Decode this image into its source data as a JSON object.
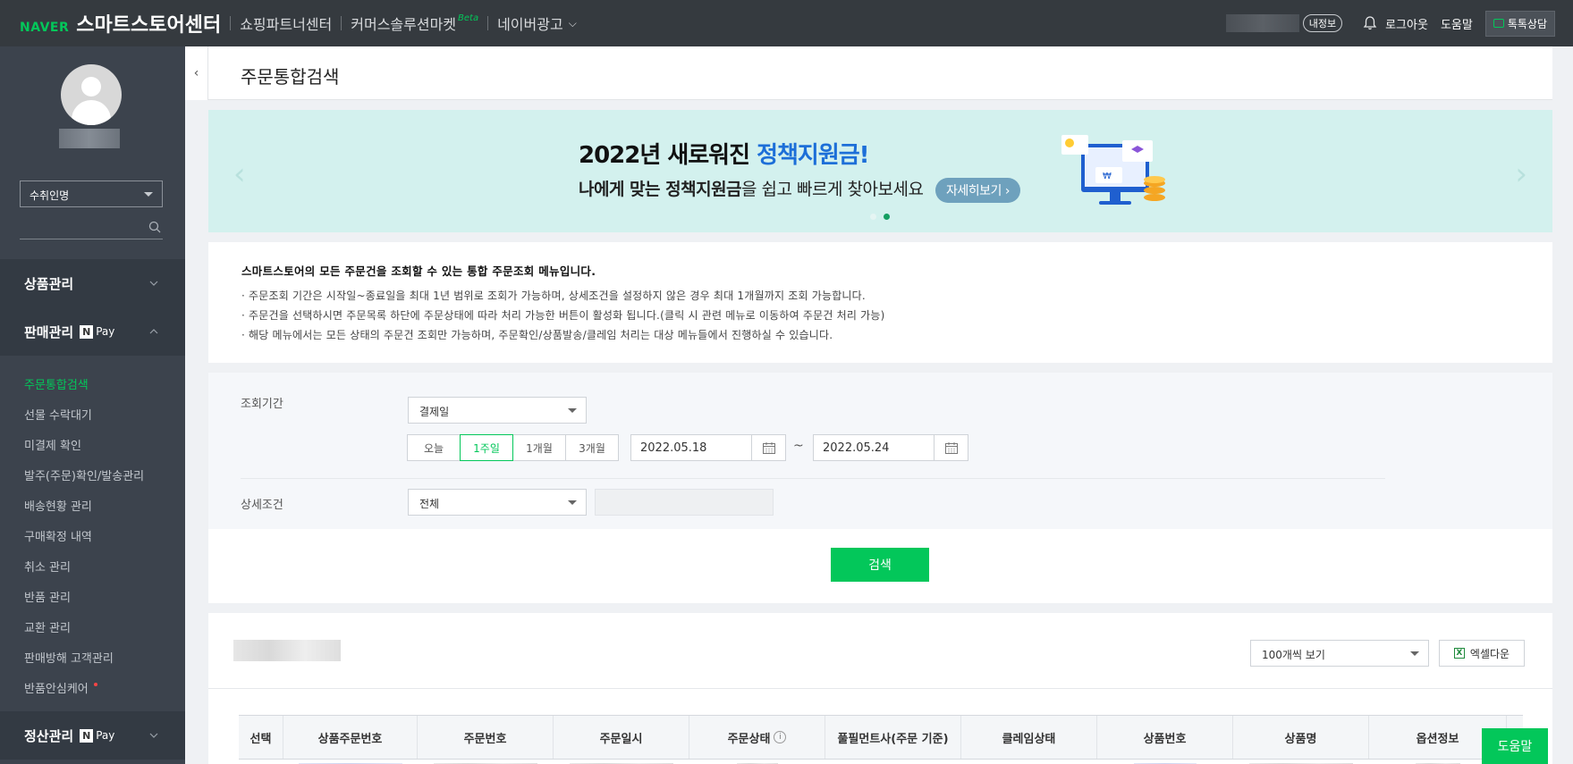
{
  "topbar": {
    "naver": "NAVER",
    "center_title": "스마트스토어센터",
    "links": [
      "쇼핑파트너센터",
      "커머스솔루션마켓",
      "네이버광고"
    ],
    "beta": "Beta",
    "my_info_badge": "내정보",
    "logout": "로그아웃",
    "help": "도움말",
    "talk": "톡톡상담"
  },
  "sidebar": {
    "recipient_select": "수취인명",
    "menus": {
      "product": "상품관리",
      "sales": "판매관리",
      "settlement": "정산관리"
    },
    "npay_label": "Pay",
    "npay_n": "N",
    "sales_items": [
      "주문통합검색",
      "선물 수락대기",
      "미결제 확인",
      "발주(주문)확인/발송관리",
      "배송현황 관리",
      "구매확정 내역",
      "취소 관리",
      "반품 관리",
      "교환 관리",
      "판매방해 고객관리",
      "반품안심케어"
    ]
  },
  "page": {
    "title": "주문통합검색"
  },
  "banner": {
    "title_plain": "2022년 새로워진 ",
    "title_highlight": "정책지원금!",
    "sub_bold": "나에게 맞는 정책지원금",
    "sub_rest": "을 쉽고 빠르게 찾아보세요",
    "button": "자세히보기 ›"
  },
  "notice": {
    "title": "스마트스토어의 모든 주문건을 조회할 수 있는 통합 주문조회 메뉴입니다.",
    "lines": [
      "· 주문조회 기간은 시작일~종료일을 최대 1년 범위로 조회가 가능하며, 상세조건을 설정하지 않은 경우 최대 1개월까지 조회 가능합니다.",
      "· 주문건을 선택하시면 주문목록 하단에 주문상태에 따라 처리 가능한 버튼이 활성화 됩니다.(클릭 시 관련 메뉴로 이동하여 주문건 처리 가능)",
      "· 해당 메뉴에서는 모든 상태의 주문건 조회만 가능하며, 주문확인/상품발송/클레임 처리는 대상 메뉴들에서 진행하실 수 있습니다."
    ]
  },
  "search": {
    "period_label": "조회기간",
    "date_type": "결제일",
    "ranges": [
      "오늘",
      "1주일",
      "1개월",
      "3개월"
    ],
    "active_range": "1주일",
    "start_date": "2022.05.18",
    "end_date": "2022.05.24",
    "tilde": "~",
    "detail_label": "상세조건",
    "detail_value": "전체",
    "search_button": "검색"
  },
  "results": {
    "page_size": "100개씩 보기",
    "excel": "엑셀다운",
    "columns": [
      "선택",
      "상품주문번호",
      "주문번호",
      "주문일시",
      "주문상태",
      "풀필먼트사(주문 기준)",
      "클레임상태",
      "상품번호",
      "상품명",
      "옵션정보"
    ]
  },
  "help_button": "도움말",
  "colors": {
    "brand_green": "#03c75a",
    "topbar": "#353a3f",
    "sidebar": "#3c434d",
    "banner_bg": "#d3f1ee",
    "banner_highlight": "#1d6fd8"
  }
}
